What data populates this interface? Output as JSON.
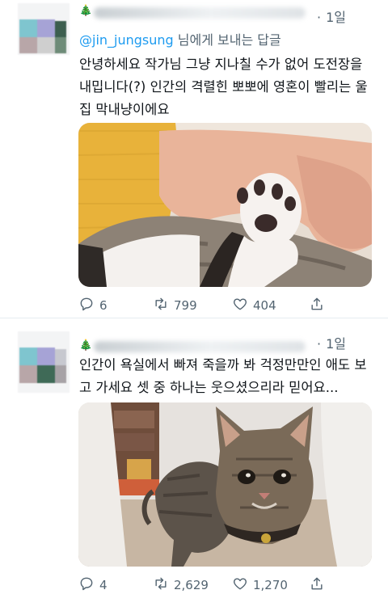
{
  "tweets": [
    {
      "time": "1일",
      "reply_handle": "@jin_jungsung",
      "reply_suffix": "님에게 보내는 답글",
      "text": "안녕하세요 작가님 그냥 지나칠 수가 없어 도전장을 내밉니다(?) 인간의 격렬힌 뽀뽀에 영혼이 빨리는 울집 막내냥이에요",
      "stats": {
        "replies": "6",
        "retweets": "799",
        "likes": "404"
      }
    },
    {
      "time": "1일",
      "text": "인간이 욕실에서 빠져 죽을까 봐 걱정만만인 애도 보고 가세요 셋 중 하나는 웃으셨으리라 믿어요...",
      "stats": {
        "replies": "4",
        "retweets": "2,629",
        "likes": "1,270"
      }
    }
  ],
  "icons": {
    "reply": "reply-icon",
    "retweet": "retweet-icon",
    "like": "like-icon",
    "share": "share-icon"
  },
  "colors": {
    "link": "#1d9bf0",
    "muted": "#536471",
    "text": "#0f1419"
  }
}
